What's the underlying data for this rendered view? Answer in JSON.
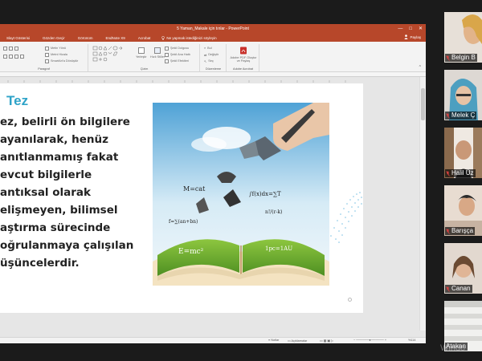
{
  "window": {
    "title": "5 Yaman_Makale için tınlar - PowerPoint",
    "controls": {
      "minimize": "—",
      "maximize": "□",
      "close": "✕"
    }
  },
  "menu": {
    "tabs": [
      "Slayt Gösterisi",
      "Gözden Geçir",
      "Görünüm",
      "EndNote X9",
      "Acrobat"
    ],
    "search_text": "Ne yapmak istediğinizi söyleyin",
    "share": "Paylaş"
  },
  "ribbon": {
    "paragraph_buttons": [
      "Metin Yönü",
      "Metni Hizala",
      "SmartArt'a Dönüştür"
    ],
    "paragraph_label": "Paragraf",
    "drawing_label": "Çizim",
    "arrange": "Yerleştir",
    "quick_styles": "Hızlı Stiller",
    "shape_buttons": [
      "Şekil Dolgusu",
      "Şekil Ana Hattı",
      "Şekil Efektleri"
    ],
    "edit_buttons": [
      "Bul",
      "Değiştir",
      "Seç"
    ],
    "edit_label": "Düzenleme",
    "adobe_button": "Adobe PDF Oluştur ve Paylaş",
    "adobe_label": "Adobe Acrobat"
  },
  "slide": {
    "title": "Tez",
    "body_lines": [
      "ez, belirli ön bilgilere",
      "ayanılarak, henüz",
      "anıtlanmamış fakat",
      "evcut bilgilerle",
      "antıksal olarak",
      "elişmeyen, bilimsel",
      "aştırma sürecinde",
      "oğrulanmaya çalışılan",
      "üşüncelerdir."
    ]
  },
  "status": {
    "notes": "Notlar",
    "comments": "Açıklamalar",
    "zoom": "%114"
  },
  "participants": [
    {
      "name": "Belgin B",
      "bg": "#c9b7a8",
      "muted": true
    },
    {
      "name": "Melek Ç",
      "bg": "#d8d2cc",
      "muted": true
    },
    {
      "name": "Halil Üz",
      "bg": "#b49a7e",
      "muted": true
    },
    {
      "name": "Barışça",
      "bg": "#d9c7b8",
      "muted": true
    },
    {
      "name": "Canan",
      "bg": "#cdb9a8",
      "muted": true
    },
    {
      "name": "Atakan",
      "bg": "#e4e4e2",
      "muted": false
    }
  ],
  "watermark": "Windo"
}
